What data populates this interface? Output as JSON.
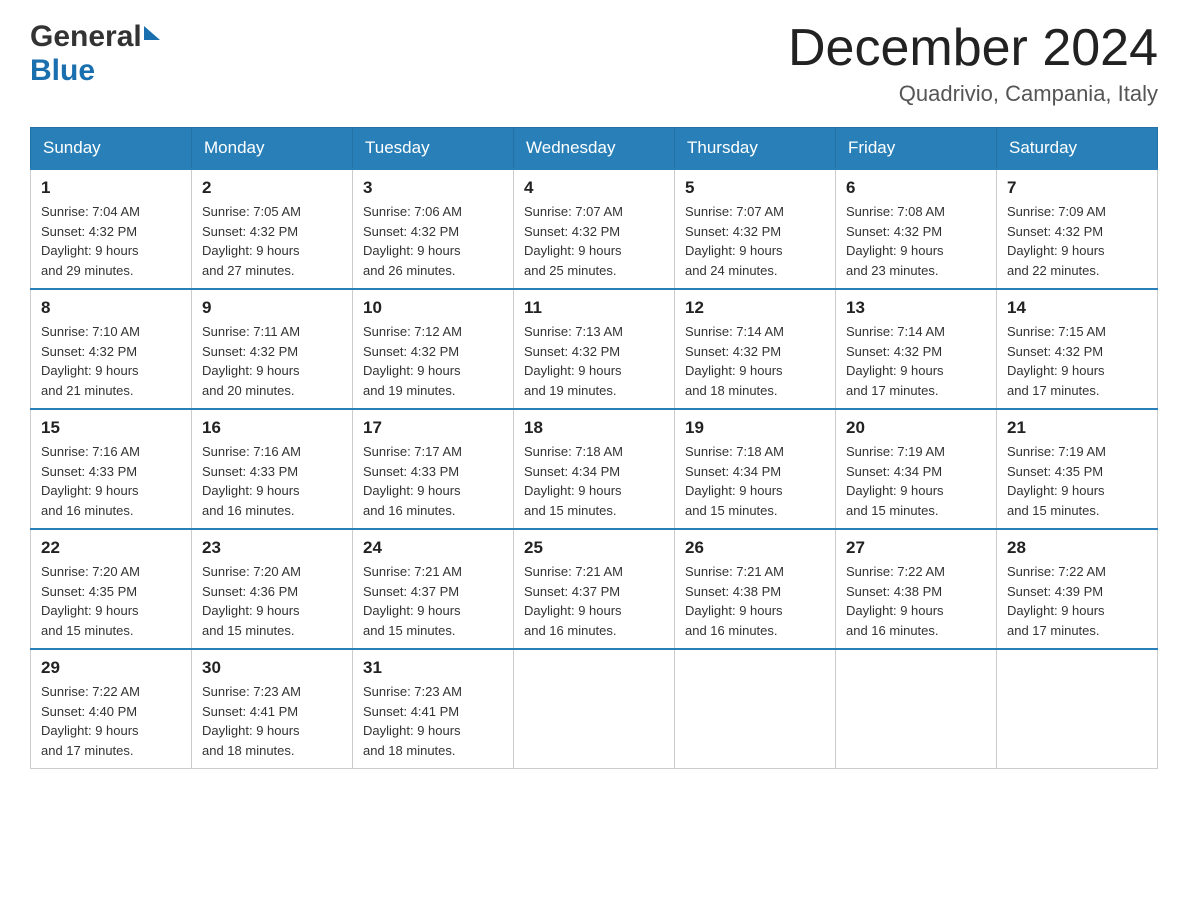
{
  "header": {
    "logo_general": "General",
    "logo_blue": "Blue",
    "month_title": "December 2024",
    "location": "Quadrivio, Campania, Italy"
  },
  "weekdays": [
    "Sunday",
    "Monday",
    "Tuesday",
    "Wednesday",
    "Thursday",
    "Friday",
    "Saturday"
  ],
  "weeks": [
    [
      {
        "day": "1",
        "sunrise": "7:04 AM",
        "sunset": "4:32 PM",
        "daylight": "9 hours and 29 minutes."
      },
      {
        "day": "2",
        "sunrise": "7:05 AM",
        "sunset": "4:32 PM",
        "daylight": "9 hours and 27 minutes."
      },
      {
        "day": "3",
        "sunrise": "7:06 AM",
        "sunset": "4:32 PM",
        "daylight": "9 hours and 26 minutes."
      },
      {
        "day": "4",
        "sunrise": "7:07 AM",
        "sunset": "4:32 PM",
        "daylight": "9 hours and 25 minutes."
      },
      {
        "day": "5",
        "sunrise": "7:07 AM",
        "sunset": "4:32 PM",
        "daylight": "9 hours and 24 minutes."
      },
      {
        "day": "6",
        "sunrise": "7:08 AM",
        "sunset": "4:32 PM",
        "daylight": "9 hours and 23 minutes."
      },
      {
        "day": "7",
        "sunrise": "7:09 AM",
        "sunset": "4:32 PM",
        "daylight": "9 hours and 22 minutes."
      }
    ],
    [
      {
        "day": "8",
        "sunrise": "7:10 AM",
        "sunset": "4:32 PM",
        "daylight": "9 hours and 21 minutes."
      },
      {
        "day": "9",
        "sunrise": "7:11 AM",
        "sunset": "4:32 PM",
        "daylight": "9 hours and 20 minutes."
      },
      {
        "day": "10",
        "sunrise": "7:12 AM",
        "sunset": "4:32 PM",
        "daylight": "9 hours and 19 minutes."
      },
      {
        "day": "11",
        "sunrise": "7:13 AM",
        "sunset": "4:32 PM",
        "daylight": "9 hours and 19 minutes."
      },
      {
        "day": "12",
        "sunrise": "7:14 AM",
        "sunset": "4:32 PM",
        "daylight": "9 hours and 18 minutes."
      },
      {
        "day": "13",
        "sunrise": "7:14 AM",
        "sunset": "4:32 PM",
        "daylight": "9 hours and 17 minutes."
      },
      {
        "day": "14",
        "sunrise": "7:15 AM",
        "sunset": "4:32 PM",
        "daylight": "9 hours and 17 minutes."
      }
    ],
    [
      {
        "day": "15",
        "sunrise": "7:16 AM",
        "sunset": "4:33 PM",
        "daylight": "9 hours and 16 minutes."
      },
      {
        "day": "16",
        "sunrise": "7:16 AM",
        "sunset": "4:33 PM",
        "daylight": "9 hours and 16 minutes."
      },
      {
        "day": "17",
        "sunrise": "7:17 AM",
        "sunset": "4:33 PM",
        "daylight": "9 hours and 16 minutes."
      },
      {
        "day": "18",
        "sunrise": "7:18 AM",
        "sunset": "4:34 PM",
        "daylight": "9 hours and 15 minutes."
      },
      {
        "day": "19",
        "sunrise": "7:18 AM",
        "sunset": "4:34 PM",
        "daylight": "9 hours and 15 minutes."
      },
      {
        "day": "20",
        "sunrise": "7:19 AM",
        "sunset": "4:34 PM",
        "daylight": "9 hours and 15 minutes."
      },
      {
        "day": "21",
        "sunrise": "7:19 AM",
        "sunset": "4:35 PM",
        "daylight": "9 hours and 15 minutes."
      }
    ],
    [
      {
        "day": "22",
        "sunrise": "7:20 AM",
        "sunset": "4:35 PM",
        "daylight": "9 hours and 15 minutes."
      },
      {
        "day": "23",
        "sunrise": "7:20 AM",
        "sunset": "4:36 PM",
        "daylight": "9 hours and 15 minutes."
      },
      {
        "day": "24",
        "sunrise": "7:21 AM",
        "sunset": "4:37 PM",
        "daylight": "9 hours and 15 minutes."
      },
      {
        "day": "25",
        "sunrise": "7:21 AM",
        "sunset": "4:37 PM",
        "daylight": "9 hours and 16 minutes."
      },
      {
        "day": "26",
        "sunrise": "7:21 AM",
        "sunset": "4:38 PM",
        "daylight": "9 hours and 16 minutes."
      },
      {
        "day": "27",
        "sunrise": "7:22 AM",
        "sunset": "4:38 PM",
        "daylight": "9 hours and 16 minutes."
      },
      {
        "day": "28",
        "sunrise": "7:22 AM",
        "sunset": "4:39 PM",
        "daylight": "9 hours and 17 minutes."
      }
    ],
    [
      {
        "day": "29",
        "sunrise": "7:22 AM",
        "sunset": "4:40 PM",
        "daylight": "9 hours and 17 minutes."
      },
      {
        "day": "30",
        "sunrise": "7:23 AM",
        "sunset": "4:41 PM",
        "daylight": "9 hours and 18 minutes."
      },
      {
        "day": "31",
        "sunrise": "7:23 AM",
        "sunset": "4:41 PM",
        "daylight": "9 hours and 18 minutes."
      },
      null,
      null,
      null,
      null
    ]
  ],
  "labels": {
    "sunrise": "Sunrise:",
    "sunset": "Sunset:",
    "daylight": "Daylight:"
  }
}
